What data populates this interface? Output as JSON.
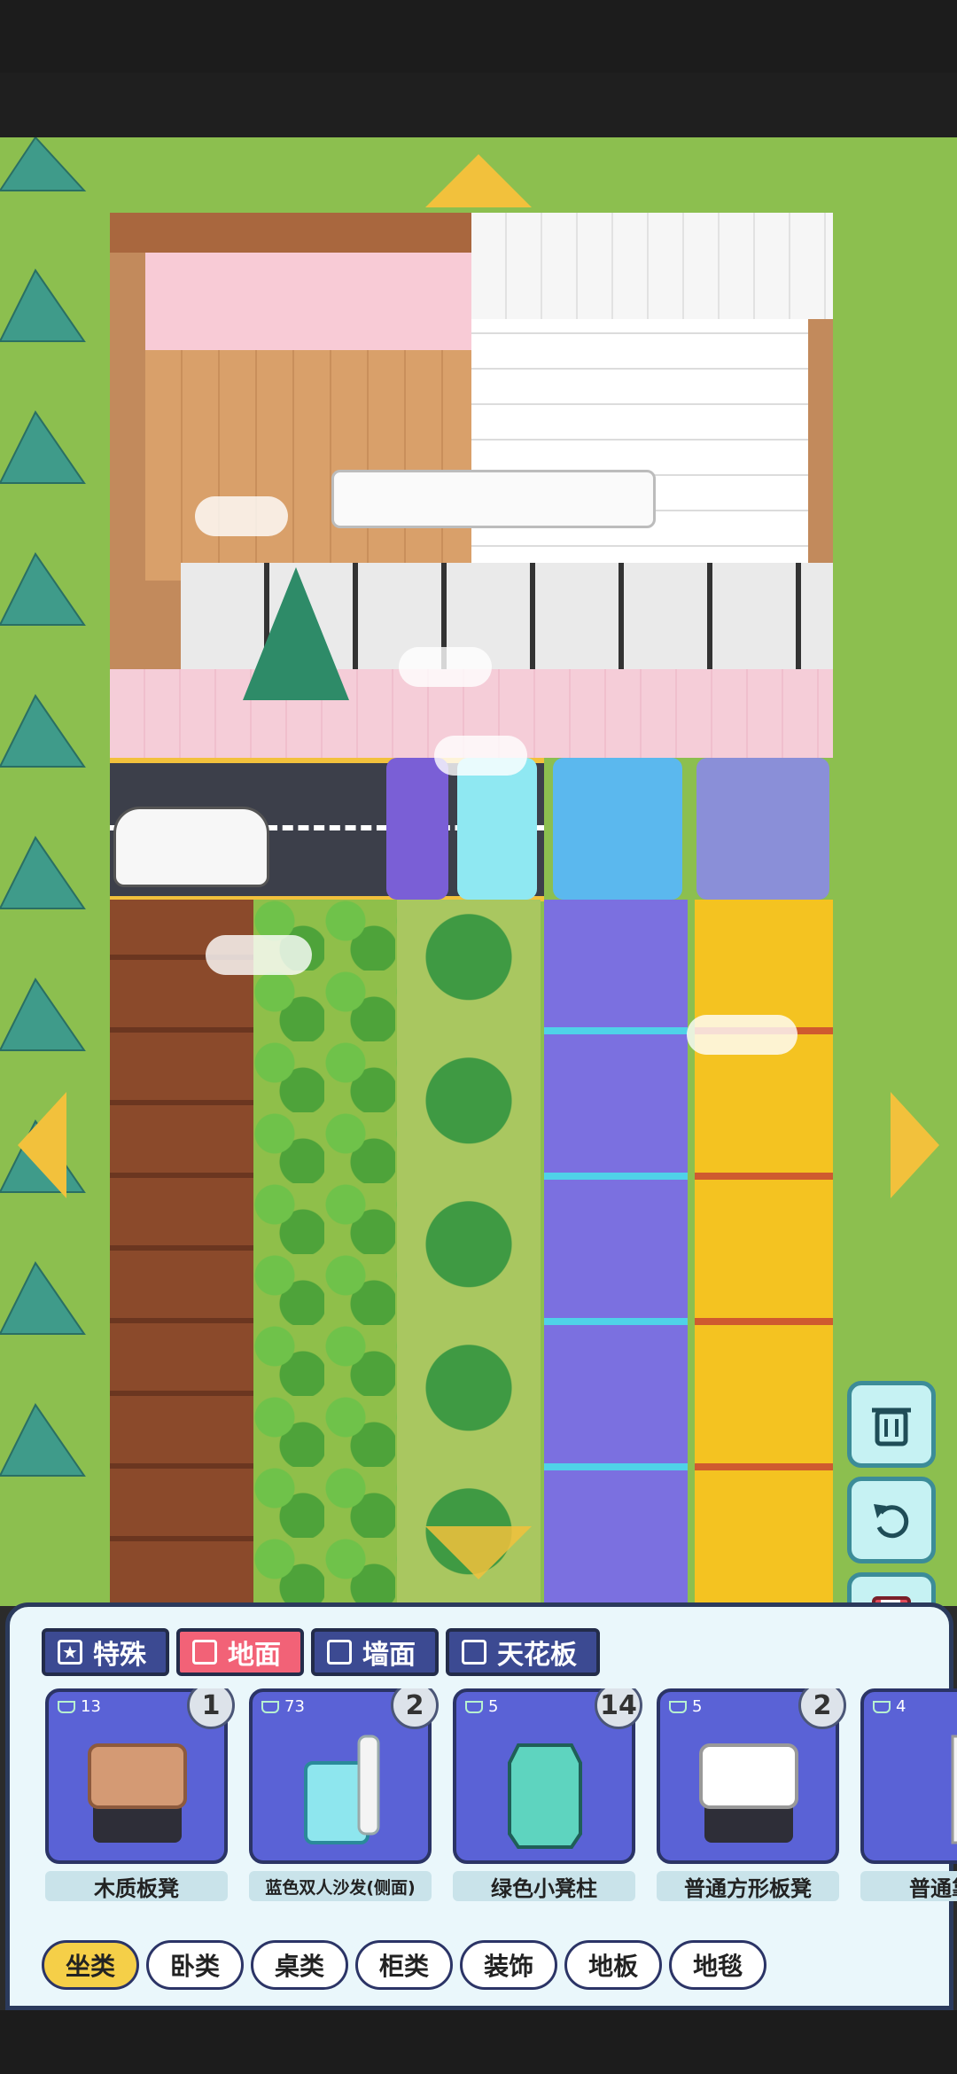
{
  "category_tabs": [
    {
      "label": "特殊",
      "icon": "star-icon"
    },
    {
      "label": "地面",
      "icon": "floor-icon",
      "active": true
    },
    {
      "label": "墙面",
      "icon": "wall-icon"
    },
    {
      "label": "天花板",
      "icon": "ceiling-icon"
    }
  ],
  "items": [
    {
      "name": "木质板凳",
      "cost": "13",
      "count": "1",
      "icon": "wooden-stool-icon"
    },
    {
      "name": "蓝色双人沙发(侧面)",
      "cost": "73",
      "count": "2",
      "icon": "blue-sofa-icon"
    },
    {
      "name": "绿色小凳柱",
      "cost": "5",
      "count": "14",
      "icon": "green-stool-icon"
    },
    {
      "name": "普通方形板凳",
      "cost": "5",
      "count": "2",
      "icon": "square-stool-icon"
    },
    {
      "name": "普通靠凳",
      "cost": "4",
      "count": "",
      "icon": "chair-icon"
    }
  ],
  "sub_tabs": [
    {
      "label": "坐类",
      "active": true
    },
    {
      "label": "卧类"
    },
    {
      "label": "桌类"
    },
    {
      "label": "柜类"
    },
    {
      "label": "装饰"
    },
    {
      "label": "地板"
    },
    {
      "label": "地毯"
    }
  ],
  "tools": [
    "trash-icon",
    "undo-icon",
    "save-icon"
  ],
  "colors": {
    "accent": "#f26277",
    "tab_blue": "#3c4a92",
    "yellow": "#f5cf48"
  }
}
